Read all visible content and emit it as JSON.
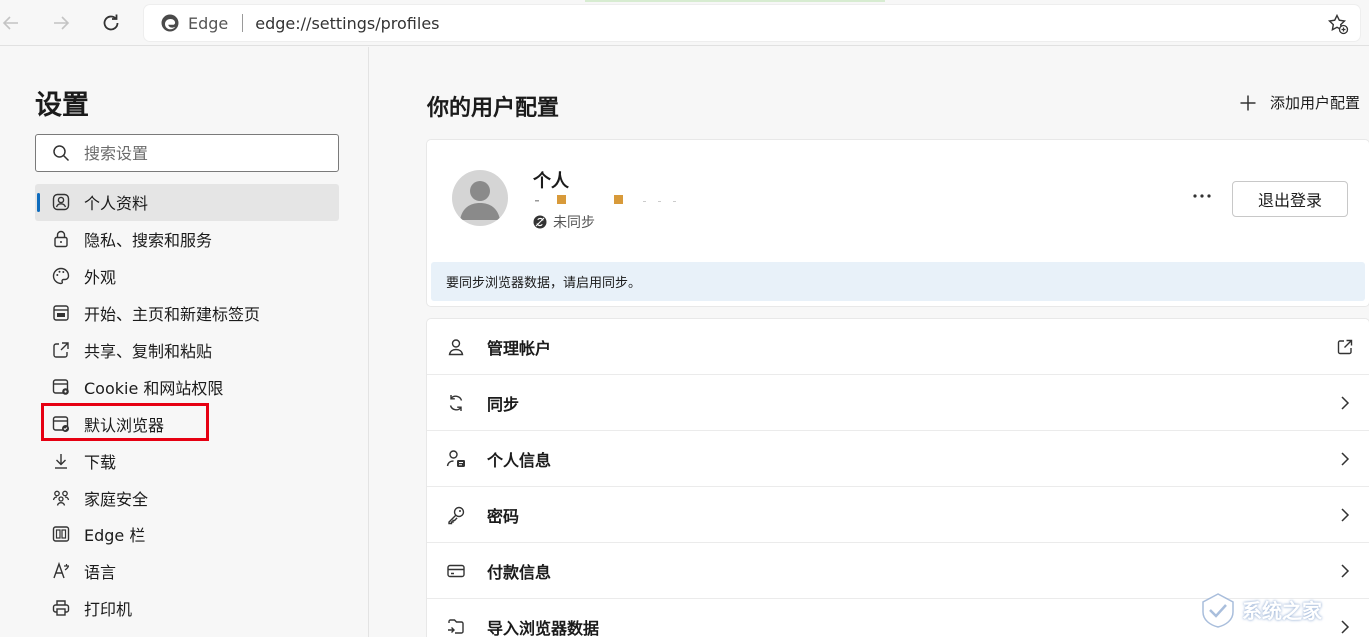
{
  "browser": {
    "brand_label": "Edge",
    "url": "edge://settings/profiles"
  },
  "sidebar": {
    "title": "设置",
    "search_placeholder": "搜索设置",
    "items": [
      {
        "label": "个人资料",
        "icon": "profile-icon"
      },
      {
        "label": "隐私、搜索和服务",
        "icon": "lock-icon"
      },
      {
        "label": "外观",
        "icon": "palette-icon"
      },
      {
        "label": "开始、主页和新建标签页",
        "icon": "start-page-icon"
      },
      {
        "label": "共享、复制和粘贴",
        "icon": "share-icon"
      },
      {
        "label": "Cookie 和网站权限",
        "icon": "cookie-permissions-icon"
      },
      {
        "label": "默认浏览器",
        "icon": "default-browser-icon"
      },
      {
        "label": "下载",
        "icon": "download-icon"
      },
      {
        "label": "家庭安全",
        "icon": "family-icon"
      },
      {
        "label": "Edge 栏",
        "icon": "edge-bar-icon"
      },
      {
        "label": "语言",
        "icon": "language-icon"
      },
      {
        "label": "打印机",
        "icon": "printer-icon"
      }
    ]
  },
  "main": {
    "title": "你的用户配置",
    "add_profile_label": "添加用户配置",
    "profile": {
      "name": "个人",
      "sync_status": "未同步",
      "signout_label": "退出登录",
      "sync_banner": "要同步浏览器数据，请启用同步。"
    },
    "options": [
      {
        "label": "管理帐户",
        "icon": "account-icon",
        "action": "external-link-icon"
      },
      {
        "label": "同步",
        "icon": "sync-icon",
        "action": "chevron-right-icon"
      },
      {
        "label": "个人信息",
        "icon": "personal-info-icon",
        "action": "chevron-right-icon"
      },
      {
        "label": "密码",
        "icon": "key-icon",
        "action": "chevron-right-icon"
      },
      {
        "label": "付款信息",
        "icon": "card-icon",
        "action": "chevron-right-icon"
      },
      {
        "label": "导入浏览器数据",
        "icon": "import-icon",
        "action": "chevron-right-icon"
      }
    ]
  },
  "watermark": {
    "text": "系统之家"
  },
  "colors": {
    "accent": "#0f6cbd",
    "highlight_box": "#e60012",
    "banner": "#e8f1f9"
  }
}
